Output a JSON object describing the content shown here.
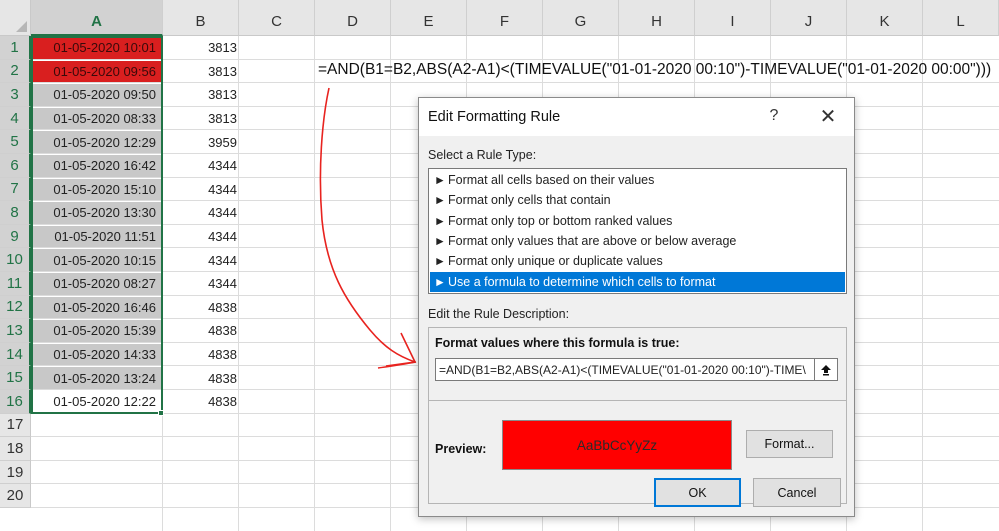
{
  "sheet": {
    "columns": [
      "A",
      "B",
      "C",
      "D",
      "E",
      "F",
      "G",
      "H",
      "I",
      "J",
      "K",
      "L"
    ],
    "rows": [
      "1",
      "2",
      "3",
      "4",
      "5",
      "6",
      "7",
      "8",
      "9",
      "10",
      "11",
      "12",
      "13",
      "14",
      "15",
      "16",
      "17",
      "18",
      "19",
      "20"
    ],
    "col_a": [
      "01-05-2020 10:01",
      "01-05-2020 09:56",
      "01-05-2020 09:50",
      "01-05-2020 08:33",
      "01-05-2020 12:29",
      "01-05-2020 16:42",
      "01-05-2020 15:10",
      "01-05-2020 13:30",
      "01-05-2020 11:51",
      "01-05-2020 10:15",
      "01-05-2020 08:27",
      "01-05-2020 16:46",
      "01-05-2020 15:39",
      "01-05-2020 14:33",
      "01-05-2020 13:24",
      "01-05-2020 12:22"
    ],
    "col_b": [
      "3813",
      "3813",
      "3813",
      "3813",
      "3959",
      "4344",
      "4344",
      "4344",
      "4344",
      "4344",
      "4344",
      "4838",
      "4838",
      "4838",
      "4838",
      "4838"
    ],
    "highlight_color": "#d91f1f",
    "selection_color": "#217346",
    "formula_annotation": "=AND(B1=B2,ABS(A2-A1)<(TIMEVALUE(\"01-01-2020 00:10\")-TIMEVALUE(\"01-01-2020 00:00\")))"
  },
  "dialog": {
    "title": "Edit Formatting Rule",
    "help_label": "?",
    "close_label": "✕",
    "select_rule_type_label": "Select a Rule Type:",
    "rule_types": [
      "Format all cells based on their values",
      "Format only cells that contain",
      "Format only top or bottom ranked values",
      "Format only values that are above or below average",
      "Format only unique or duplicate values",
      "Use a formula to determine which cells to format"
    ],
    "rule_arrow_icon": "►",
    "selected_rule_index": 5,
    "edit_description_label": "Edit the Rule Description:",
    "formula_heading": "Format values where this formula is true:",
    "formula_value": "=AND(B1=B2,ABS(A2-A1)<(TIMEVALUE(\"01-01-2020 00:10\")-TIME\\",
    "collapse_icon": "upload-arrow-icon",
    "preview_label": "Preview:",
    "preview_sample": "AaBbCcYyZz",
    "preview_fill": "#ff0000",
    "format_button": "Format...",
    "ok_button": "OK",
    "cancel_button": "Cancel",
    "accent_color": "#0078d7"
  },
  "annotation": {
    "arrow_color": "#e8231f"
  }
}
